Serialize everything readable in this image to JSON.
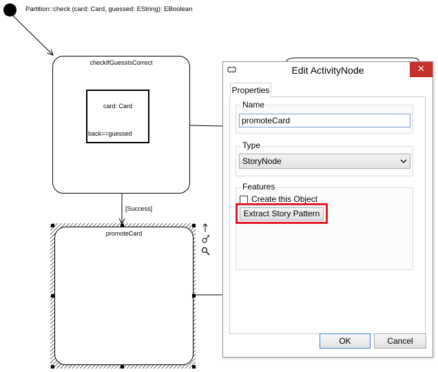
{
  "diagram": {
    "start_label": "Partition::check (card: Card, guessed: EString): EBoolean",
    "node1": {
      "title": "checkIfGuessIsCorrect",
      "inner_object": "card: Card",
      "inner_constraint": "back==guessed"
    },
    "transition_label": "[Success]",
    "node2": {
      "title": "promoteCard"
    }
  },
  "dialog": {
    "title": "Edit ActivityNode",
    "close": "✕",
    "tab": "Properties",
    "name_group": "Name",
    "name_value": "promoteCard",
    "type_group": "Type",
    "type_value": "StoryNode",
    "features_group": "Features",
    "checkbox_label": "Create this Object",
    "extract_button": "Extract Story Pattern",
    "ok_button": "OK",
    "cancel_button": "Cancel",
    "highlight_color": "#e01b24"
  }
}
